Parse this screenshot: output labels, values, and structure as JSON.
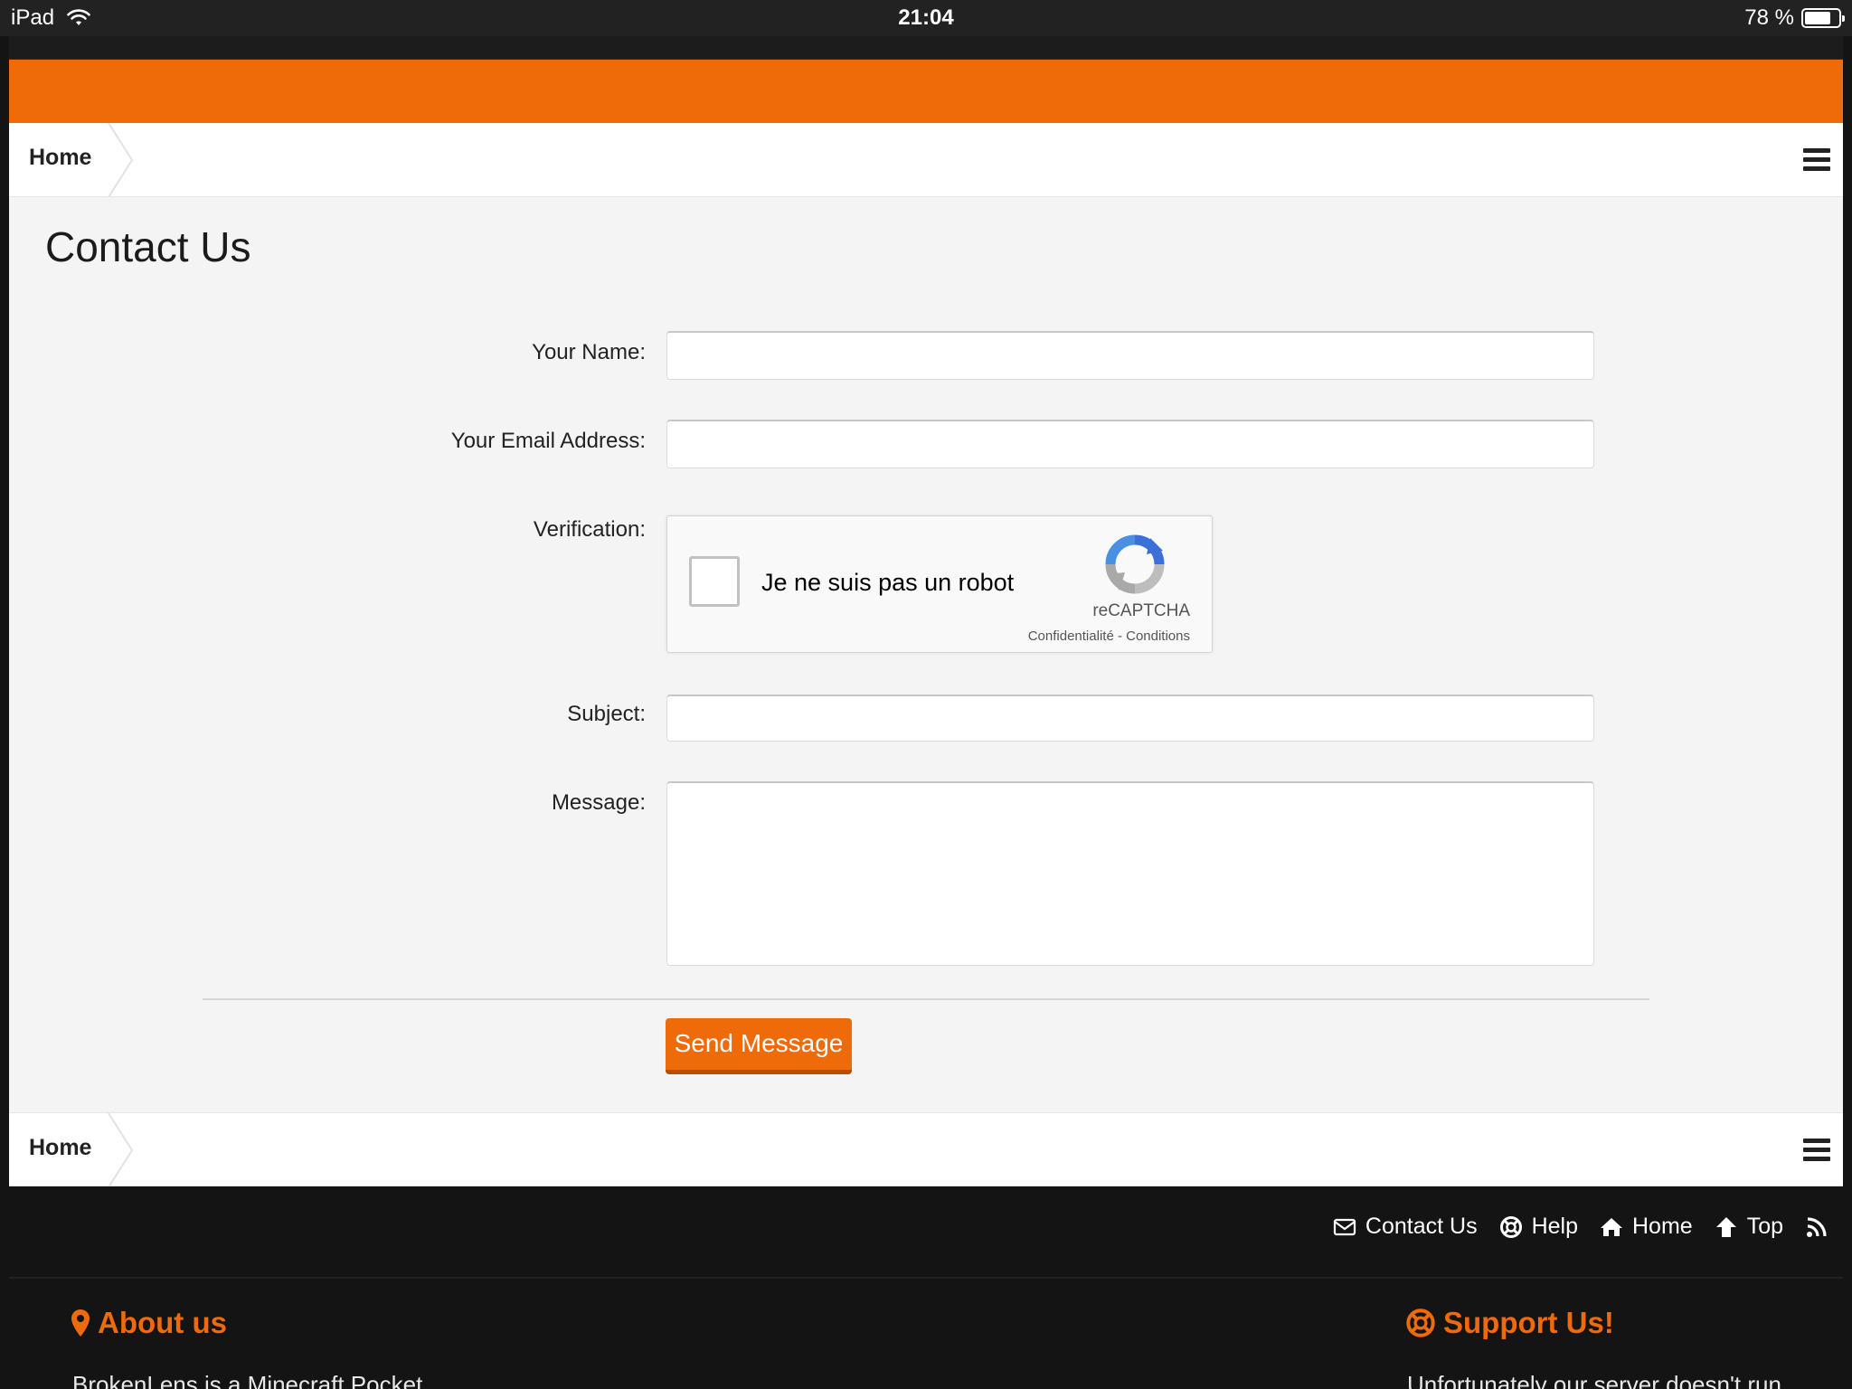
{
  "status_bar": {
    "device": "iPad",
    "time": "21:04",
    "battery": "78 %",
    "battery_level": 0.78
  },
  "breadcrumb": {
    "home_label": "Home"
  },
  "page": {
    "title": "Contact Us"
  },
  "form": {
    "name_label": "Your Name:",
    "name_value": "",
    "email_label": "Your Email Address:",
    "email_value": "",
    "verification_label": "Verification:",
    "subject_label": "Subject:",
    "subject_value": "",
    "message_label": "Message:",
    "message_value": "",
    "submit_label": "Send Message"
  },
  "recaptcha": {
    "checkbox_label": "Je ne suis pas un robot",
    "brand": "reCAPTCHA",
    "links": "Confidentialité - Conditions"
  },
  "footer": {
    "links": {
      "contact": "Contact Us",
      "help": "Help",
      "home": "Home",
      "top": "Top"
    },
    "about_heading": "About us",
    "about_text": "BrokenLens is a Minecraft Pocket",
    "support_heading": "Support Us!",
    "support_text": "Unfortunately our server doesn't run"
  },
  "colors": {
    "accent": "#ef6a08",
    "accent_dark": "#b84e00",
    "page_bg": "#f4f4f4",
    "footer_bg": "#141414"
  }
}
